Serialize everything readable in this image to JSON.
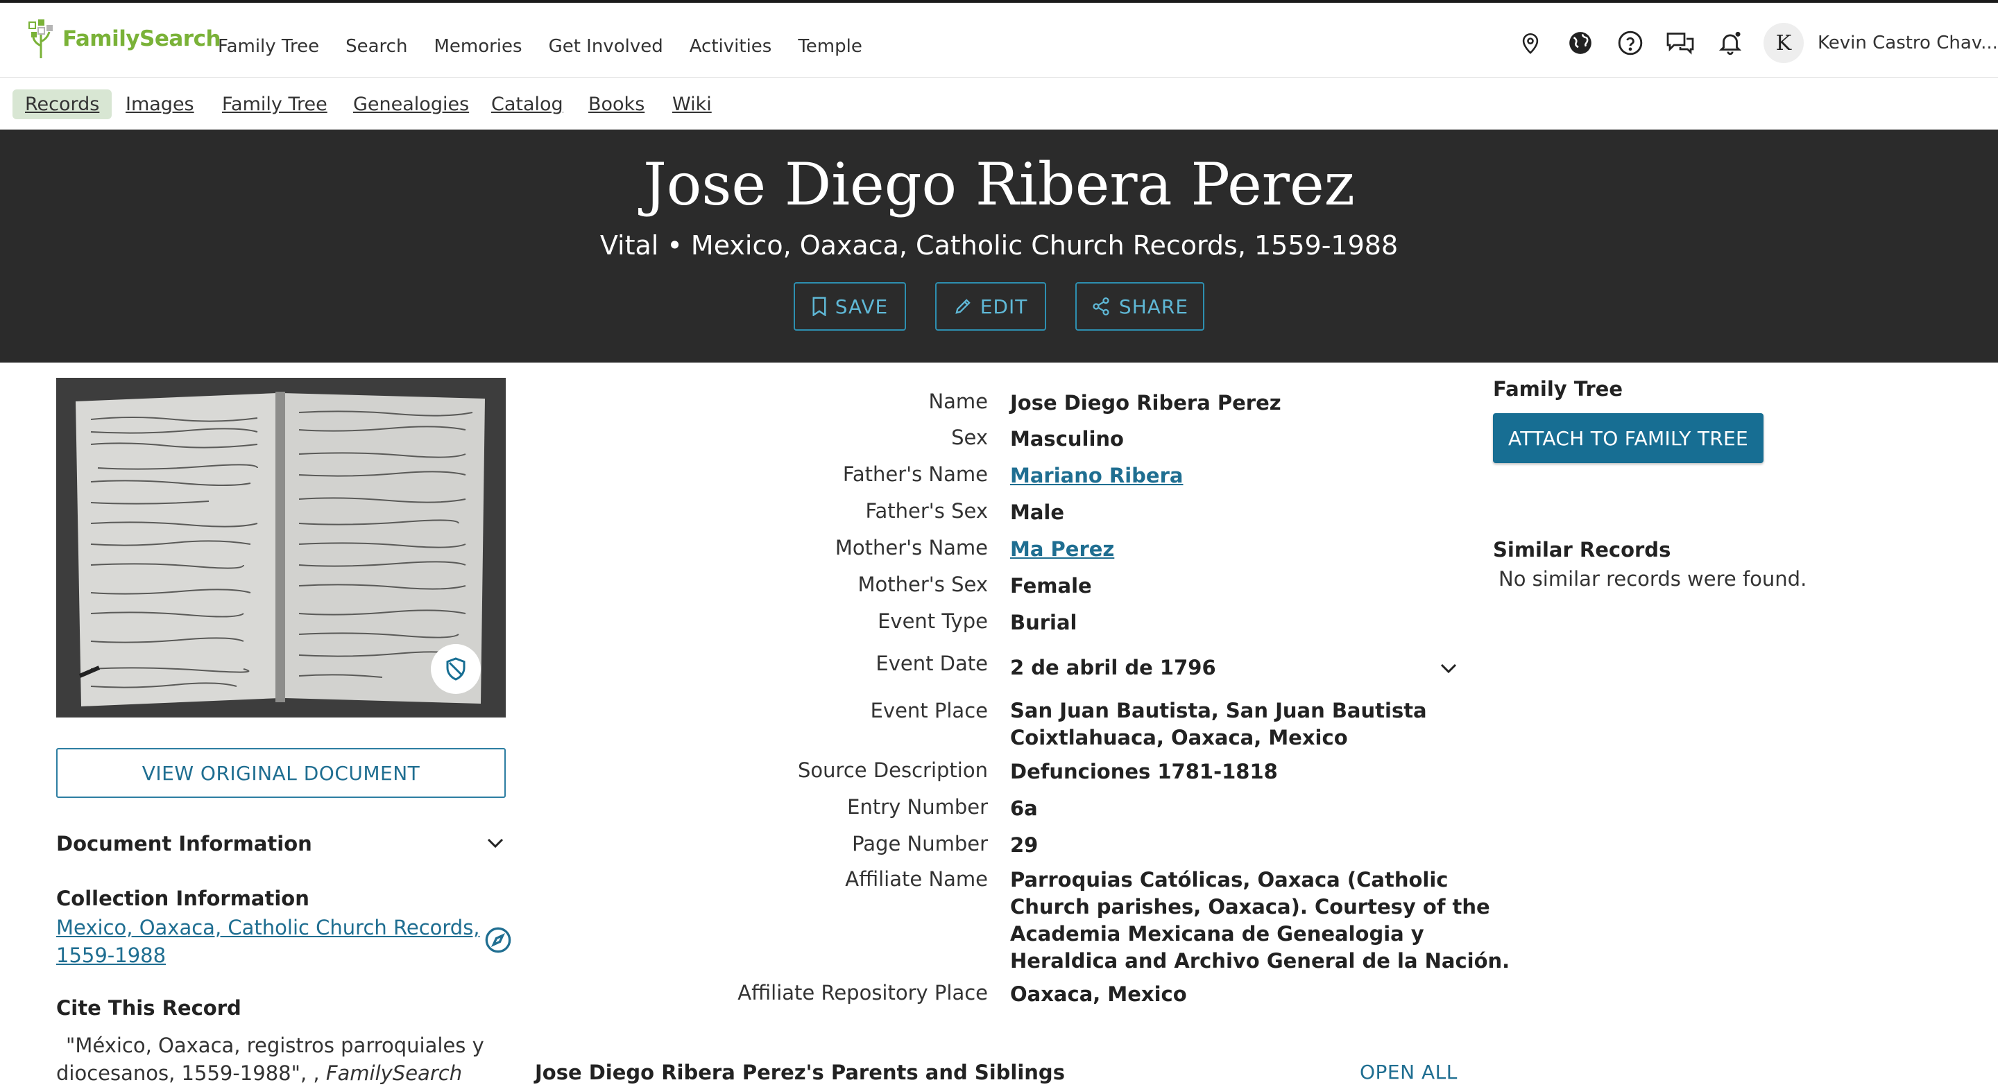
{
  "header": {
    "logo_text": "FamilySearch",
    "nav": [
      "Family Tree",
      "Search",
      "Memories",
      "Get Involved",
      "Activities",
      "Temple"
    ],
    "icons": [
      "location-pin-icon",
      "globe-icon",
      "help-icon",
      "chat-icon",
      "bell-icon"
    ],
    "avatar_initial": "K",
    "user_name": "Kevin Castro Chav..."
  },
  "subnav": {
    "items": [
      "Records",
      "Images",
      "Family Tree",
      "Genealogies",
      "Catalog",
      "Books",
      "Wiki"
    ],
    "active": "Records"
  },
  "hero": {
    "title": "Jose Diego Ribera Perez",
    "subtitle": "Vital • Mexico, Oaxaca, Catholic Church Records, 1559-1988",
    "buttons": {
      "save": "SAVE",
      "edit": "EDIT",
      "share": "SHARE"
    }
  },
  "left": {
    "view_button": "VIEW ORIGINAL DOCUMENT",
    "document_info_heading": "Document Information",
    "collection_heading": "Collection Information",
    "collection_link_line1": "Mexico, Oaxaca, Catholic Church Records,",
    "collection_link_line2": "1559-1988",
    "cite_heading": "Cite This Record",
    "cite_line1": "\"México, Oaxaca, registros parroquiales y",
    "cite_line2_a": "diocesanos, 1559-1988\", , ",
    "cite_line2_b": "FamilySearch"
  },
  "record": {
    "fields": [
      {
        "label": "Name",
        "value": "Jose Diego Ribera Perez"
      },
      {
        "label": "Sex",
        "value": "Masculino"
      },
      {
        "label": "Father's Name",
        "value": "Mariano Ribera"
      },
      {
        "label": "Father's Sex",
        "value": "Male"
      },
      {
        "label": "Mother's Name",
        "value": "Ma Perez"
      },
      {
        "label": "Mother's Sex",
        "value": "Female"
      },
      {
        "label": "Event Type",
        "value": "Burial"
      },
      {
        "label": "Event Date",
        "value": "2 de abril de 1796"
      },
      {
        "label": "Event Place",
        "value_line1": "San Juan Bautista, San Juan Bautista",
        "value_line2": "Coixtlahuaca, Oaxaca, Mexico"
      },
      {
        "label": "Source Description",
        "value": "Defunciones 1781-1818"
      },
      {
        "label": "Entry Number",
        "value": "6a"
      },
      {
        "label": "Page Number",
        "value": "29"
      },
      {
        "label": "Affiliate Name",
        "value_line1": "Parroquias Católicas, Oaxaca (Catholic",
        "value_line2": "Church parishes, Oaxaca). Courtesy of the",
        "value_line3": "Academia Mexicana de Genealogia y",
        "value_line4": "Heraldica and Archivo General de la Nación."
      },
      {
        "label": "Affiliate Repository Place",
        "value": "Oaxaca, Mexico"
      }
    ],
    "parents_heading": "Jose Diego Ribera Perez's Parents and Siblings",
    "open_all": "OPEN ALL"
  },
  "right": {
    "family_tree_heading": "Family Tree",
    "attach_button": "ATTACH TO FAMILY TREE",
    "similar_heading": "Similar Records",
    "similar_text": "No similar records were found."
  },
  "colors": {
    "accent": "#176e93",
    "link": "#1f6e91",
    "hero_bg": "#2b2b2b",
    "brand_green": "#7ab238",
    "active_tab_bg": "#d8e6d3"
  }
}
